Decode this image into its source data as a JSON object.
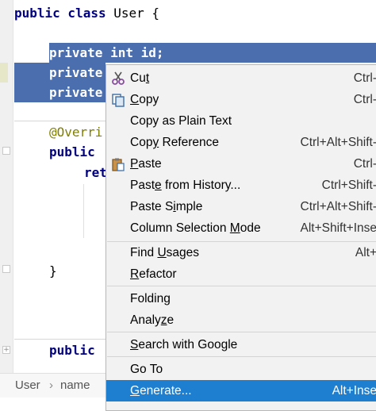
{
  "editor": {
    "class_line": {
      "kw": "public class",
      "name": " User {"
    },
    "field1": "private int id;",
    "field2": "private",
    "field3": "private",
    "annotation": "@Overri",
    "method_kw": "public",
    "ret": "ret",
    "close_brace": "}",
    "method2_kw": "public"
  },
  "breadcrumb": {
    "class": "User",
    "arrow": "›",
    "member": "name"
  },
  "context_menu": {
    "items": [
      {
        "label": "Cut",
        "shortcut": "Ctrl-",
        "icon": "scissors-icon"
      },
      {
        "label": "Copy",
        "shortcut": "Ctrl-",
        "icon": "copy-icon"
      },
      {
        "label": "Copy as Plain Text",
        "shortcut": ""
      },
      {
        "label": "Copy Reference",
        "shortcut": "Ctrl+Alt+Shift-"
      },
      {
        "label": "Paste",
        "shortcut": "Ctrl-",
        "icon": "clipboard-icon"
      },
      {
        "label": "Paste from History...",
        "shortcut": "Ctrl+Shift-"
      },
      {
        "label": "Paste Simple",
        "shortcut": "Ctrl+Alt+Shift-"
      },
      {
        "label": "Column Selection Mode",
        "shortcut": "Alt+Shift+Inse"
      },
      {
        "label": "Find Usages",
        "shortcut": "Alt+"
      },
      {
        "label": "Refactor",
        "shortcut": ""
      },
      {
        "label": "Folding",
        "shortcut": ""
      },
      {
        "label": "Analyze",
        "shortcut": ""
      },
      {
        "label": "Search with Google",
        "shortcut": ""
      },
      {
        "label": "Go To",
        "shortcut": ""
      },
      {
        "label": "Generate...",
        "shortcut": "Alt+Inse",
        "highlighted": true
      }
    ]
  },
  "colors": {
    "selection": "#4b6eaf",
    "menu_highlight": "#1e7fd0",
    "keyword": "#000080",
    "annotation": "#808000"
  }
}
